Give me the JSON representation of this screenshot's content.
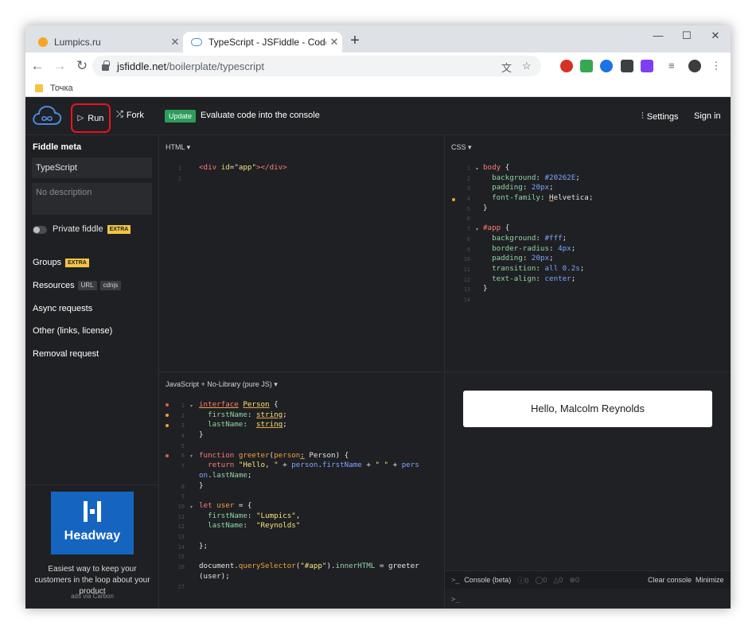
{
  "browser": {
    "tabs": [
      {
        "title": "Lumpics.ru",
        "close": "✕"
      },
      {
        "title": "TypeScript - JSFiddle - Code Playground",
        "close": "✕"
      }
    ],
    "new_tab": "+",
    "window": {
      "minimize": "—",
      "maximize": "☐",
      "close": "✕"
    },
    "nav": {
      "back": "←",
      "forward": "→",
      "reload": "↻"
    },
    "url_host": "jsfiddle.net",
    "url_path": "/boilerplate/typescript",
    "bookmark": "Точка"
  },
  "header": {
    "run_label": "Run",
    "fork_label": "Fork",
    "update_tag": "Update",
    "update_text": "Evaluate code into the console",
    "settings_label": "Settings",
    "signin_label": "Sign in"
  },
  "sidebar": {
    "title": "Fiddle meta",
    "fiddle_name": "TypeScript",
    "description_placeholder": "No description",
    "private_label": "Private fiddle",
    "extra_badge": "EXTRA",
    "links": {
      "groups": "Groups",
      "resources": "Resources",
      "resources_url": "URL",
      "resources_cdnjs": "cdnjs",
      "async": "Async requests",
      "other": "Other (links, license)",
      "removal": "Removal request"
    },
    "ad": {
      "brand": "Headway",
      "text": "Easiest way to keep your customers in the loop about your product",
      "via": "ads via Carbon"
    }
  },
  "panels": {
    "html_label": "HTML ▾",
    "css_label": "CSS ▾",
    "js_label": "JavaScript + No-Library (pure JS) ▾"
  },
  "result": {
    "hello_text": "Hello, Malcolm Reynolds",
    "console_label": "Console (beta)",
    "counts": [
      "0",
      "0",
      "0",
      "0"
    ],
    "clear_label": "Clear console",
    "minimize_label": "Minimize",
    "prompt": ">_"
  },
  "colors": {
    "run_highlight": "#e8141c",
    "update_green": "#2c9d5b",
    "ad_blue": "#1565c0",
    "extra_yellow": "#f4c542"
  }
}
